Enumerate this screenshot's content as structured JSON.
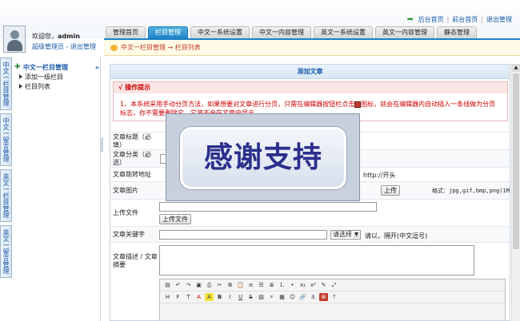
{
  "header": {
    "welcome_prefix": "欢迎您，",
    "username": "admin",
    "role_text": "超级管理员 - 退出管理",
    "links": [
      "后台首页",
      "前台首页",
      "退出管理"
    ],
    "link_sep": "|"
  },
  "tabs": [
    {
      "label": "管理首页",
      "active": false
    },
    {
      "label": "栏目管理",
      "active": true
    },
    {
      "label": "中文一系统设置",
      "active": false
    },
    {
      "label": "中文一内容管理",
      "active": false
    },
    {
      "label": "英文一系统设置",
      "active": false
    },
    {
      "label": "英文一内容管理",
      "active": false
    },
    {
      "label": "静态管理",
      "active": false
    }
  ],
  "breadcrumb": "中文一栏目管理 → 栏目列表",
  "side_tabs": [
    "中文一栏目管理",
    "中文一留言管理",
    "英文一栏目管理",
    "英文一留言管理"
  ],
  "menu": {
    "title": "中文一栏目管理",
    "collapse": "»",
    "items": [
      "添加一级栏目",
      "栏目列表"
    ]
  },
  "panel": {
    "title": "添加文章",
    "tips_title": "√ 操作提示",
    "tips_text_a": "1、本系统采用手动分页方法，如果想要对文章进行分页，只需在编辑器按钮栏点击",
    "tips_text_b": "图标，就会在编辑器内自动插入一条线做为分页标志，你不需要删除它，它将不会在文章中显示。",
    "fields": {
      "title_label": "文章标题（必填）",
      "category_label": "文章分类（必选）",
      "jump_label": "文章跳转地址",
      "jump_hint": "http://开头",
      "image_label": "文章图片",
      "upload_btn": "上传",
      "format_hint": "格式：jpg,gif,bmp,png(1M",
      "file_label": "上传文件",
      "file_btn": "上传文件",
      "keywords_label": "文章关键字",
      "keywords_select": "请选择",
      "keywords_hint": "请以，隔开(中文逗号)",
      "desc_label": "文章描述 / 文章摘要"
    }
  },
  "overlay_text": "感谢支持",
  "colors": {
    "accent": "#1d82c4",
    "tips_red": "#c00",
    "link": "#1a5aa8"
  }
}
